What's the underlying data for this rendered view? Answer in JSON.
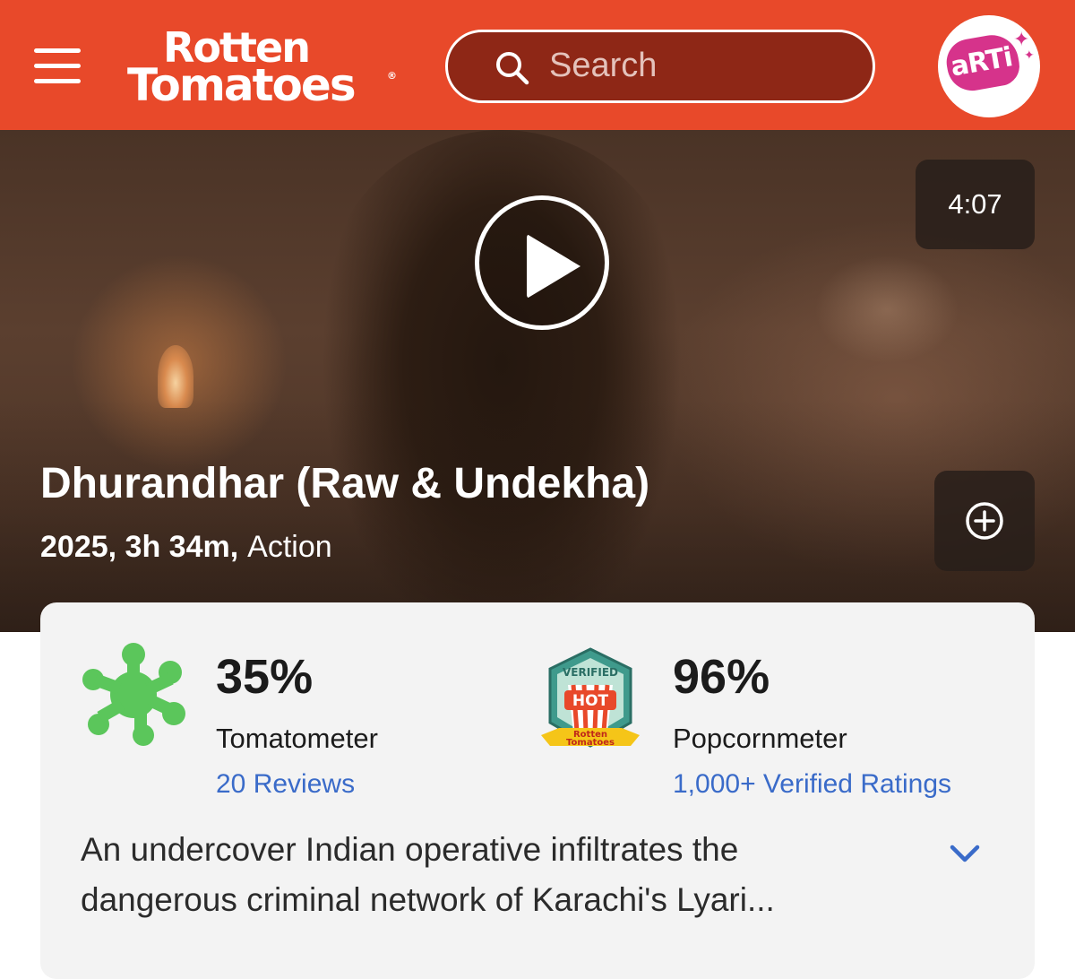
{
  "header": {
    "logo_line1": "Rotten",
    "logo_line2": "Tomatoes",
    "logo_reg": "®",
    "search_placeholder": "Search",
    "avatar_text": "aRTi",
    "brand_color": "#e8492a"
  },
  "hero": {
    "duration": "4:07",
    "title": "Dhurandhar (Raw & Undekha)",
    "year_runtime": "2025, 3h 34m,",
    "genre": "Action"
  },
  "scores": {
    "tomatometer": {
      "value": "35%",
      "label": "Tomatometer",
      "link": "20 Reviews",
      "icon": "green-splat-icon",
      "icon_color": "#5bc65b"
    },
    "popcornmeter": {
      "value": "96%",
      "label": "Popcornmeter",
      "link": "1,000+ Verified Ratings",
      "badge_top": "VERIFIED",
      "badge_mid": "HOT",
      "badge_brand_1": "Rotten",
      "badge_brand_2": "Tomatoes"
    },
    "link_color": "#3a6bc9"
  },
  "synopsis": "An undercover Indian operative infiltrates the dangerous criminal network of Karachi's Lyari..."
}
